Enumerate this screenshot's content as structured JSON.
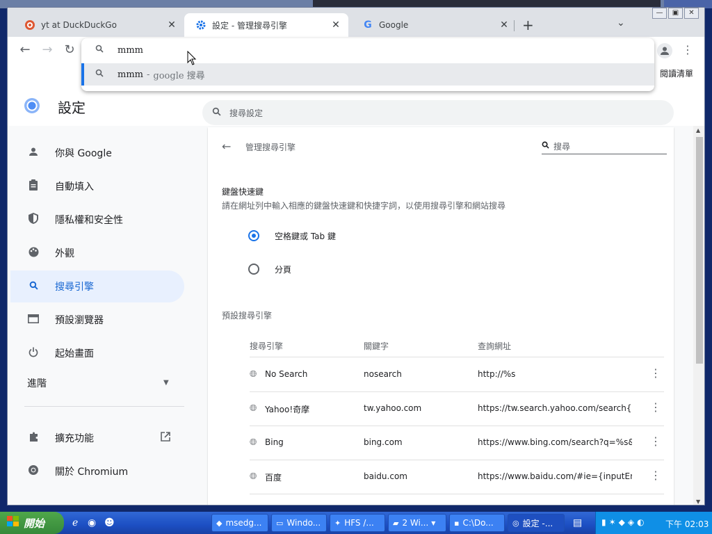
{
  "tabs": [
    {
      "title": "yt at DuckDuckGo",
      "icon": "duckduckgo-icon",
      "active": false
    },
    {
      "title": "設定 - 管理搜尋引擎",
      "icon": "gear-icon",
      "active": true
    },
    {
      "title": "Google",
      "icon": "google-icon",
      "active": false
    }
  ],
  "toolbar": {
    "reading_list": "閱讀清單"
  },
  "omnibox": {
    "query": "mmm",
    "suggestion_query": "mmm",
    "suggestion_sep": "-",
    "suggestion_engine": "google 搜尋"
  },
  "settings": {
    "title": "設定",
    "search_placeholder": "搜尋設定"
  },
  "sidebar": {
    "items": [
      {
        "label": "你與 Google",
        "icon": "person-icon"
      },
      {
        "label": "自動填入",
        "icon": "clipboard-icon"
      },
      {
        "label": "隱私權和安全性",
        "icon": "shield-icon"
      },
      {
        "label": "外觀",
        "icon": "palette-icon"
      },
      {
        "label": "搜尋引擎",
        "icon": "search-icon",
        "active": true
      },
      {
        "label": "預設瀏覽器",
        "icon": "browser-icon"
      },
      {
        "label": "起始畫面",
        "icon": "power-icon"
      }
    ],
    "advanced": "進階",
    "extensions": "擴充功能",
    "about": "關於 Chromium"
  },
  "panel": {
    "title": "管理搜尋引擎",
    "search_placeholder": "搜尋",
    "shortcut_heading": "鍵盤快速鍵",
    "shortcut_desc": "請在網址列中輸入相應的鍵盤快速鍵和快捷字詞，以使用搜尋引擎和網站搜尋",
    "radio_space_tab": "空格鍵或 Tab 鍵",
    "radio_tab": "分頁",
    "default_engines": "預設搜尋引擎",
    "columns": [
      "搜尋引擎",
      "關鍵字",
      "查詢網址"
    ],
    "engines": [
      {
        "name": "No Search",
        "keyword": "nosearch",
        "url": "http://%s"
      },
      {
        "name": "Yahoo!奇摩",
        "keyword": "tw.yahoo.com",
        "url": "https://tw.search.yahoo.com/search{g"
      },
      {
        "name": "Bing",
        "keyword": "bing.com",
        "url": "https://www.bing.com/search?q=%s&f"
      },
      {
        "name": "百度",
        "keyword": "baidu.com",
        "url": "https://www.baidu.com/#ie={inputEnc"
      }
    ]
  },
  "taskbar": {
    "start": "開始",
    "tasks": [
      {
        "label": "msedg...",
        "icon": "edge-icon"
      },
      {
        "label": "Windo...",
        "icon": "computer-icon"
      },
      {
        "label": "HFS /...",
        "icon": "hfs-icon"
      },
      {
        "label": "2 Wi...",
        "icon": "folder-icon"
      },
      {
        "label": "C:\\Do...",
        "icon": "7zip-icon"
      },
      {
        "label": "設定 -...",
        "icon": "chromium-icon",
        "active": true
      }
    ],
    "clock": "下午 02:03"
  }
}
